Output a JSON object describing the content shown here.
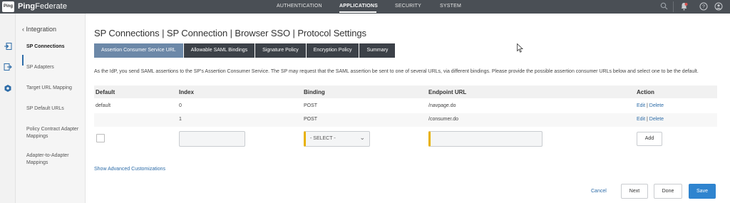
{
  "header": {
    "logo_text": "Ping",
    "brand_bold": "Ping",
    "brand_light": "Federate",
    "nav": [
      "AUTHENTICATION",
      "APPLICATIONS",
      "SECURITY",
      "SYSTEM"
    ],
    "active_nav": "APPLICATIONS"
  },
  "sidebar": {
    "back_label": "Integration",
    "items": [
      "SP Connections",
      "SP Adapters",
      "Target URL Mapping",
      "SP Default URLs",
      "Policy Contract Adapter Mappings",
      "Adapter-to-Adapter Mappings"
    ]
  },
  "main": {
    "title": "SP Connections | SP Connection | Browser SSO | Protocol Settings",
    "tabs": [
      "Assertion Consumer Service URL",
      "Allowable SAML Bindings",
      "Signature Policy",
      "Encryption Policy",
      "Summary"
    ],
    "active_tab": "Assertion Consumer Service URL",
    "description": "As the IdP, you send SAML assertions to the SP's Assertion Consumer Service. The SP may request that the SAML assertion be sent to one of several URLs, via different bindings. Please provide the possible assertion consumer URLs below and select one to be the default.",
    "table": {
      "headers": [
        "Default",
        "Index",
        "Binding",
        "Endpoint URL",
        "Action"
      ],
      "rows": [
        {
          "default": "default",
          "index": "0",
          "binding": "POST",
          "endpoint": "/navpage.do",
          "edit": "Edit",
          "sep": "|",
          "delete": "Delete"
        },
        {
          "default": "",
          "index": "1",
          "binding": "POST",
          "endpoint": "/consumer.do",
          "edit": "Edit",
          "sep": "|",
          "delete": "Delete"
        }
      ],
      "new_row": {
        "select_value": "- SELECT -",
        "add_label": "Add"
      }
    },
    "advanced_link": "Show Advanced Customizations"
  },
  "footer": {
    "cancel": "Cancel",
    "next": "Next",
    "done": "Done",
    "save": "Save"
  },
  "colors": {
    "topbar": "#4a4f55",
    "tab_dark": "#3c4148",
    "tab_active": "#6c88a8",
    "link": "#2d6ca8",
    "primary": "#2f84cf",
    "required": "#e8b100"
  }
}
